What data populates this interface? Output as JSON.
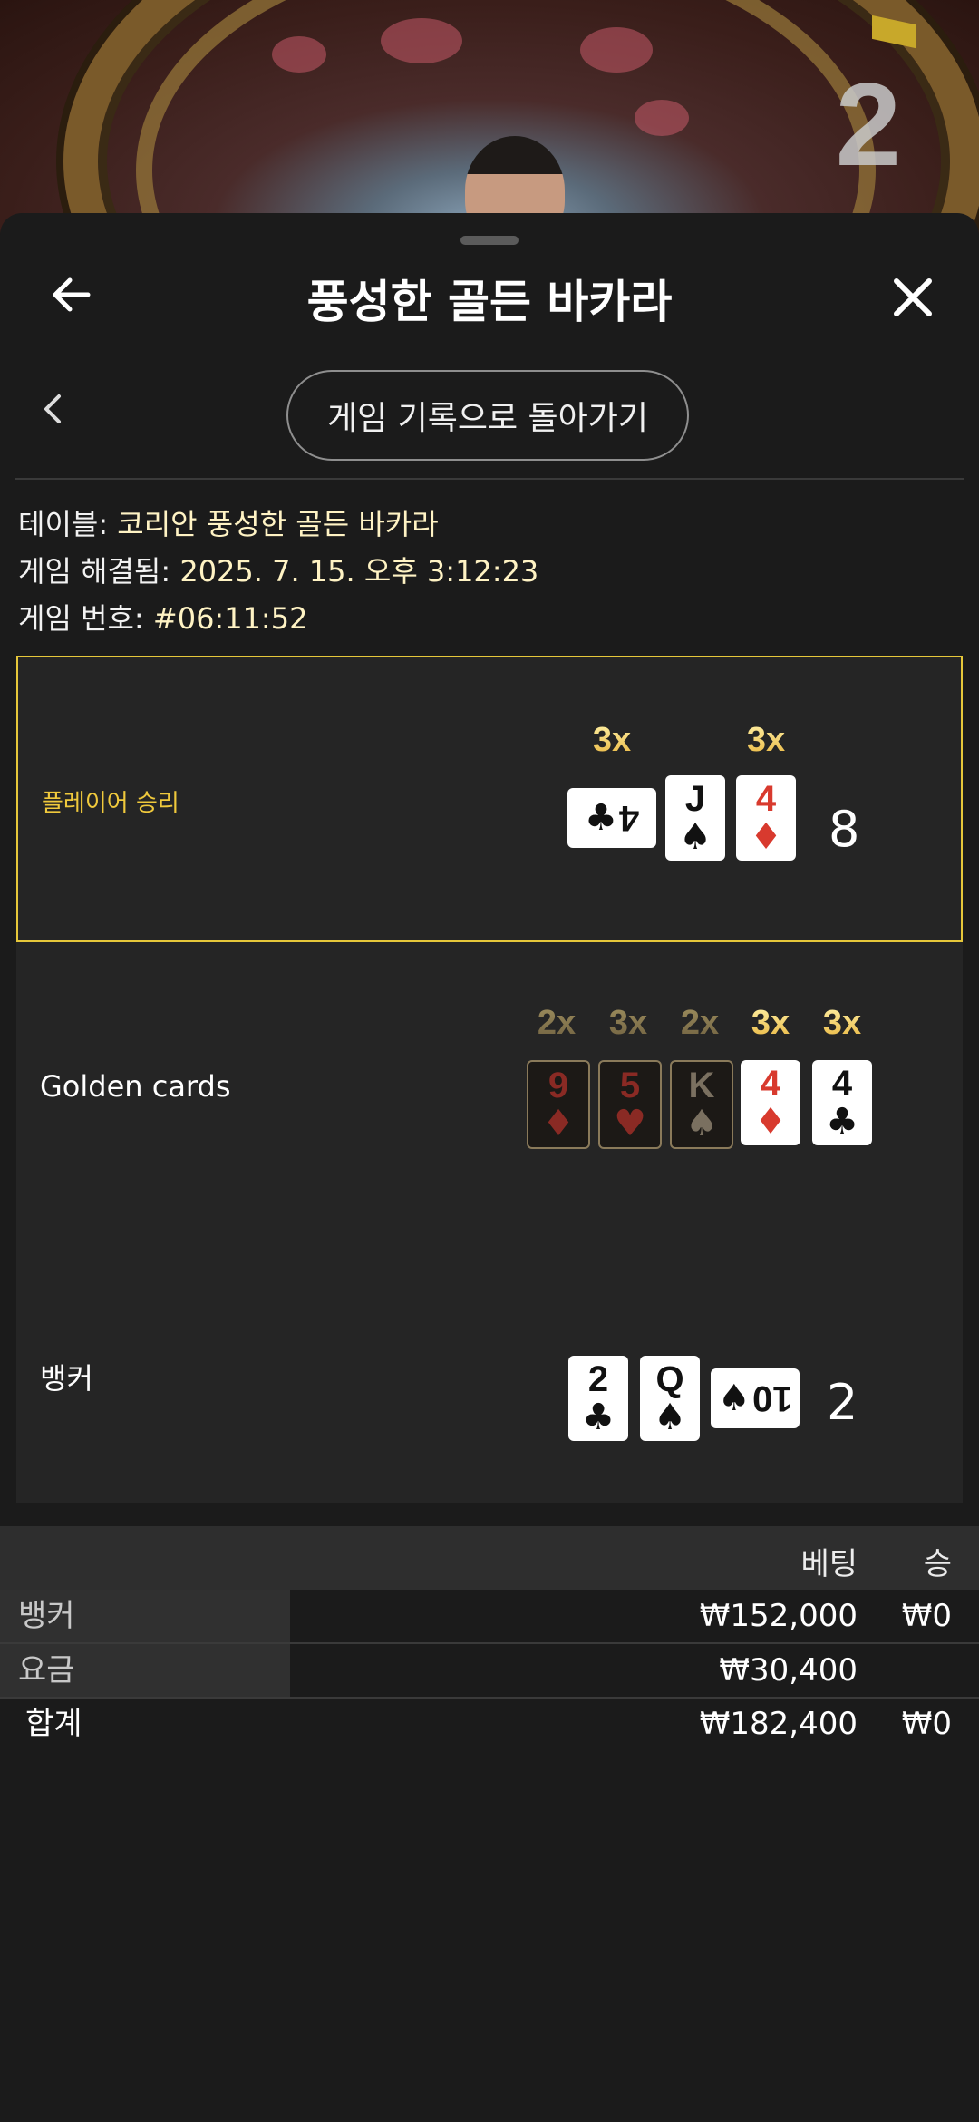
{
  "header": {
    "title": "풍성한 골든 바카라"
  },
  "background": {
    "table_number": "2"
  },
  "nav": {
    "back_to_history_label": "게임 기록으로 돌아가기"
  },
  "info": {
    "table_label": "테이블:",
    "table_value": "코리안 풍성한 골든 바카라",
    "resolved_label": "게임 해결됨:",
    "resolved_value": "2025. 7. 15. 오후 3:12:23",
    "game_no_label": "게임 번호:",
    "game_no_value": "#06:11:52"
  },
  "outcomes": {
    "player": {
      "label": "플레이어 승리",
      "score": "8",
      "cards": [
        {
          "rank": "4",
          "suit": "♣",
          "color": "black",
          "sideways": true,
          "multiplier": "3x"
        },
        {
          "rank": "J",
          "suit": "♠",
          "color": "black",
          "sideways": false,
          "multiplier": ""
        },
        {
          "rank": "4",
          "suit": "♦",
          "color": "red",
          "sideways": false,
          "multiplier": "3x"
        }
      ]
    },
    "golden": {
      "label": "Golden cards",
      "cards": [
        {
          "rank": "9",
          "suit": "♦",
          "color": "red",
          "dim": true,
          "multiplier": "2x"
        },
        {
          "rank": "5",
          "suit": "♥",
          "color": "red",
          "dim": true,
          "multiplier": "3x"
        },
        {
          "rank": "K",
          "suit": "♠",
          "color": "black",
          "dim": true,
          "multiplier": "2x"
        },
        {
          "rank": "4",
          "suit": "♦",
          "color": "red",
          "dim": false,
          "multiplier": "3x"
        },
        {
          "rank": "4",
          "suit": "♣",
          "color": "black",
          "dim": false,
          "multiplier": "3x"
        }
      ]
    },
    "banker": {
      "label": "뱅커",
      "score": "2",
      "cards": [
        {
          "rank": "2",
          "suit": "♣",
          "color": "black",
          "sideways": false
        },
        {
          "rank": "Q",
          "suit": "♠",
          "color": "black",
          "sideways": false
        },
        {
          "rank": "10",
          "suit": "♠",
          "color": "black",
          "sideways": true
        }
      ]
    }
  },
  "bets": {
    "col_bet": "베팅",
    "col_win": "승",
    "rows": [
      {
        "label": "뱅커",
        "bet": "₩152,000",
        "win": "₩0"
      },
      {
        "label": "요금",
        "bet": "₩30,400",
        "win": ""
      }
    ],
    "total": {
      "label": "합계",
      "bet": "₩182,400",
      "win": "₩0"
    }
  },
  "colors": {
    "accent_gold": "#f0c93c",
    "sheet_bg": "#1b1b1b",
    "row_bg": "#252525"
  },
  "icons": {
    "back": "arrow-left-icon",
    "close": "close-icon",
    "chevron": "chevron-left-icon"
  }
}
